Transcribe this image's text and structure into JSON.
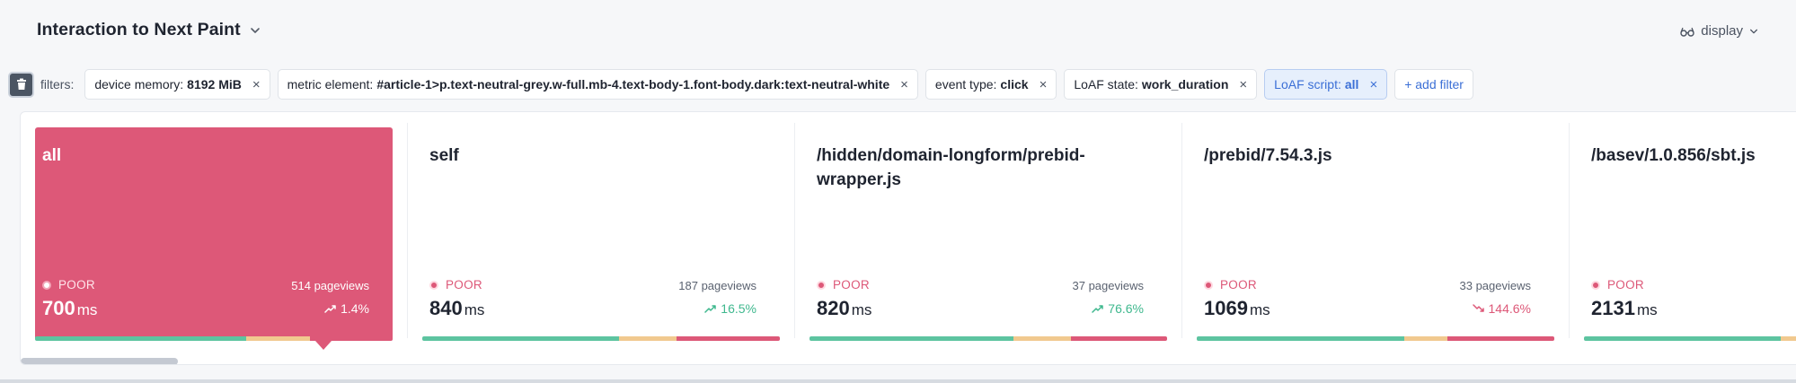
{
  "header": {
    "title": "Interaction to Next Paint",
    "display_label": "display"
  },
  "filters": {
    "label": "filters:",
    "chips": [
      {
        "key": "device memory:",
        "value": "8192 MiB"
      },
      {
        "key": "metric element:",
        "value": "#article-1>p.text-neutral-grey.w-full.mb-4.text-body-1.font-body.dark:text-neutral-white"
      },
      {
        "key": "event type:",
        "value": "click"
      },
      {
        "key": "LoAF state:",
        "value": "work_duration"
      },
      {
        "key": "LoAF script:",
        "value": "all",
        "active": true
      }
    ],
    "add_label": "+ add filter"
  },
  "cards": [
    {
      "name": "all",
      "status": "POOR",
      "pageviews": "514 pageviews",
      "value": "700",
      "unit": "ms",
      "trend": "1.4%",
      "trend_direction": "up",
      "selected": true,
      "distribution": {
        "good": 0.59,
        "needs_improvement": 0.18,
        "poor": 0.23
      }
    },
    {
      "name": "self",
      "status": "POOR",
      "pageviews": "187 pageviews",
      "value": "840",
      "unit": "ms",
      "trend": "16.5%",
      "trend_direction": "up",
      "selected": false,
      "distribution": {
        "good": 0.55,
        "needs_improvement": 0.16,
        "poor": 0.29
      }
    },
    {
      "name": "/hidden/domain-longform/prebid-wrapper.js",
      "status": "POOR",
      "pageviews": "37 pageviews",
      "value": "820",
      "unit": "ms",
      "trend": "76.6%",
      "trend_direction": "up",
      "selected": false,
      "distribution": {
        "good": 0.57,
        "needs_improvement": 0.16,
        "poor": 0.27
      }
    },
    {
      "name": "/prebid/7.54.3.js",
      "status": "POOR",
      "pageviews": "33 pageviews",
      "value": "1069",
      "unit": "ms",
      "trend": "144.6%",
      "trend_direction": "down",
      "selected": false,
      "distribution": {
        "good": 0.58,
        "needs_improvement": 0.12,
        "poor": 0.3
      }
    },
    {
      "name": "/basev/1.0.856/sbt.js",
      "status": "POOR",
      "pageviews": "",
      "value": "2131",
      "unit": "ms",
      "trend": "",
      "trend_direction": "",
      "selected": false,
      "distribution": {
        "good": 0.55,
        "needs_improvement": 0.14,
        "poor": 0.31
      }
    }
  ],
  "colors": {
    "poor": "#dd5878",
    "good": "#5dc4a0",
    "needs_improvement": "#f1c98f",
    "accent": "#3b6fd6"
  },
  "icons": [
    "chevron-down-icon",
    "glasses-icon",
    "trash-icon",
    "close-icon",
    "trend-up-icon",
    "trend-down-icon"
  ]
}
